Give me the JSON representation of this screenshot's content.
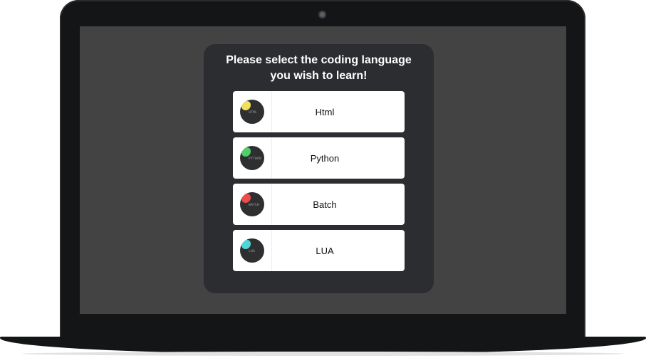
{
  "prompt": {
    "line1": "Please select the coding language",
    "line2": "you wish to learn!"
  },
  "options": [
    {
      "label": "Html",
      "icon_text": "HTML",
      "accent": "#f2e05a",
      "icon": "html-icon"
    },
    {
      "label": "Python",
      "icon_text": "PYTHON",
      "accent": "#4fcf6a",
      "icon": "python-icon"
    },
    {
      "label": "Batch",
      "icon_text": "BATCH",
      "accent": "#ee4b4b",
      "icon": "batch-icon"
    },
    {
      "label": "LUA",
      "icon_text": "LUA",
      "accent": "#4fd6d6",
      "icon": "lua-icon"
    }
  ],
  "colors": {
    "screen_bg": "#434343",
    "card_bg": "#2b2d30",
    "bezel": "#141516"
  }
}
